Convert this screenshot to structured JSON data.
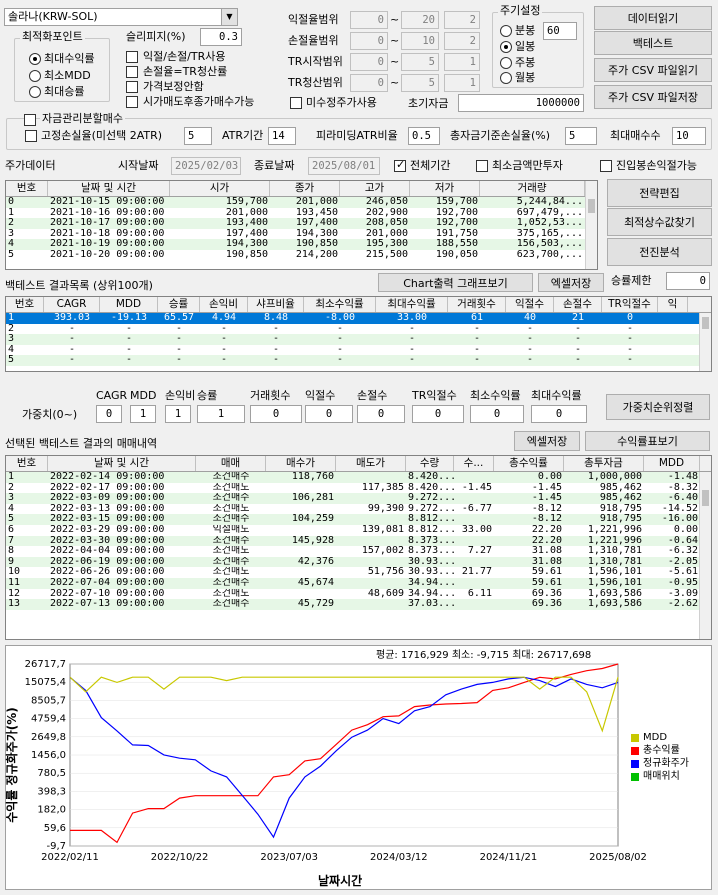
{
  "top": {
    "symbol_select": "솔라나(KRW-SOL)",
    "optimization": {
      "title": "최적화포인트",
      "options": [
        "최대수익률",
        "최소MDD",
        "최대승률"
      ],
      "selected": 0
    },
    "slippage_label": "슬리피지(%)",
    "slippage_value": "0.3",
    "checks": [
      {
        "label": "익절/손절/TR사용",
        "checked": false
      },
      {
        "label": "손절율=TR청산률",
        "checked": false
      },
      {
        "label": "가격보정안함",
        "checked": false
      },
      {
        "label": "시가매도후종가매수가능",
        "checked": false
      }
    ],
    "ranges": [
      {
        "label": "익절율범위",
        "from": "0",
        "to": "20",
        "step": "2"
      },
      {
        "label": "손절율범위",
        "from": "0",
        "to": "10",
        "step": "2"
      },
      {
        "label": "TR시작범위",
        "from": "0",
        "to": "5",
        "step": "1"
      },
      {
        "label": "TR청산범위",
        "from": "0",
        "to": "5",
        "step": "1"
      }
    ],
    "range_sep": "~",
    "unclosed_label": "미수정주가사용",
    "capital_label": "초기자금",
    "capital_value": "1000000",
    "period": {
      "title": "주기설정",
      "options": [
        "분봉",
        "일봉",
        "주봉",
        "월봉"
      ],
      "selected": 1,
      "minute_value": "60"
    },
    "buttons": [
      "데이터읽기",
      "백테스트",
      "주가 CSV 파일읽기",
      "주가 CSV 파일저장"
    ]
  },
  "split": {
    "title": "자금관리분할매수",
    "fixed_loss_label": "고정손실율(미선택 2ATR)",
    "fixed_loss_value": "5",
    "atr_label": "ATR기간",
    "atr_value": "14",
    "pyramid_label": "피라미딩ATR비율",
    "pyramid_value": "0.5",
    "total_loss_label": "총자금기준손실율(%)",
    "total_loss_value": "5",
    "max_buy_label": "최대매수수",
    "max_buy_value": "10"
  },
  "stock": {
    "title": "주가데이터",
    "start_label": "시작날짜",
    "start_value": "2025/02/03",
    "end_label": "종료날짜",
    "end_value": "2025/08/01",
    "all_period_label": "전체기간",
    "min_invest_label": "최소금액만투자",
    "entry_loss_label": "진입봉손익절가능",
    "headers": [
      "번호",
      "날짜 및 시간",
      "시가",
      "종가",
      "고가",
      "저가",
      "거래량"
    ],
    "rows": [
      [
        "0",
        "2021-10-15 09:00:00",
        "159,700",
        "201,000",
        "246,050",
        "159,700",
        "5,244,84..."
      ],
      [
        "1",
        "2021-10-16 09:00:00",
        "201,000",
        "193,450",
        "202,900",
        "192,700",
        "697,479,..."
      ],
      [
        "2",
        "2021-10-17 09:00:00",
        "193,400",
        "197,400",
        "208,050",
        "192,700",
        "1,052,53..."
      ],
      [
        "3",
        "2021-10-18 09:00:00",
        "197,400",
        "194,300",
        "201,000",
        "191,750",
        "375,165,..."
      ],
      [
        "4",
        "2021-10-19 09:00:00",
        "194,300",
        "190,850",
        "195,300",
        "188,550",
        "156,503,..."
      ],
      [
        "5",
        "2021-10-20 09:00:00",
        "190,850",
        "214,200",
        "215,500",
        "190,050",
        "623,700,..."
      ]
    ],
    "side_buttons": [
      "전략편집",
      "최적상수값찾기",
      "전진분석"
    ]
  },
  "backtest": {
    "title": "백테스트  결과목록 (상위100개)",
    "chart_btn": "Chart출력 그래프보기",
    "excel_btn": "엑셀저장",
    "limit_label": "승률제한",
    "limit_value": "0",
    "headers": [
      "번호",
      "CAGR",
      "MDD",
      "승률",
      "손익비",
      "샤프비율",
      "최소수익률",
      "최대수익률",
      "거래횟수",
      "익절수",
      "손절수",
      "TR익절수",
      "익"
    ],
    "rows": [
      [
        "1",
        "393.03",
        "-19.13",
        "65.57",
        "4.94",
        "8.48",
        "-8.00",
        "33.00",
        "61",
        "40",
        "21",
        "0",
        ""
      ],
      [
        "2",
        "-",
        "-",
        "-",
        "-",
        "-",
        "-",
        "-",
        "-",
        "-",
        "-",
        "-",
        ""
      ],
      [
        "3",
        "-",
        "-",
        "-",
        "-",
        "-",
        "-",
        "-",
        "-",
        "-",
        "-",
        "-",
        ""
      ],
      [
        "4",
        "-",
        "-",
        "-",
        "-",
        "-",
        "-",
        "-",
        "-",
        "-",
        "-",
        "-",
        ""
      ],
      [
        "5",
        "-",
        "-",
        "-",
        "-",
        "-",
        "-",
        "-",
        "-",
        "-",
        "-",
        "-",
        ""
      ]
    ],
    "weights_label": "가중치(0~)",
    "weight_headers": [
      "CAGR",
      "MDD",
      "손익비",
      "승률",
      "거래횟수",
      "익절수",
      "손절수",
      "TR익절수",
      "최소수익률",
      "최대수익률"
    ],
    "weight_values": [
      "0",
      "1",
      "1",
      "1",
      "0",
      "0",
      "0",
      "0",
      "0",
      "0"
    ],
    "weight_sort_btn": "가중치순위정렬"
  },
  "trades": {
    "title": "선택된 백테스트 결과의 매매내역",
    "excel_btn": "엑셀저장",
    "profit_btn": "수익률표보기",
    "headers": [
      "번호",
      "날짜 및 시간",
      "매매",
      "매수가",
      "매도가",
      "수량",
      "수...",
      "총수익률",
      "총투자금",
      "MDD"
    ],
    "rows": [
      [
        "1",
        "2022-02-14 09:00:00",
        "조건매수",
        "118,760",
        "",
        "8.420...",
        "",
        "0.00",
        "1,000,000",
        "-1.48"
      ],
      [
        "2",
        "2022-02-17 09:00:00",
        "조건매도",
        "",
        "117,385",
        "8.420...",
        "-1.45",
        "-1.45",
        "985,462",
        "-8.32"
      ],
      [
        "3",
        "2022-03-09 09:00:00",
        "조건매수",
        "106,281",
        "",
        "9.272...",
        "",
        "-1.45",
        "985,462",
        "-6.40"
      ],
      [
        "4",
        "2022-03-13 09:00:00",
        "조건매도",
        "",
        "99,390",
        "9.272...",
        "-6.77",
        "-8.12",
        "918,795",
        "-14.52"
      ],
      [
        "5",
        "2022-03-15 09:00:00",
        "조건매수",
        "104,259",
        "",
        "8.812...",
        "",
        "-8.12",
        "918,795",
        "-16.00"
      ],
      [
        "6",
        "2022-03-29 09:00:00",
        "익절매도",
        "",
        "139,081",
        "8.812...",
        "33.00",
        "22.20",
        "1,221,996",
        "0.00"
      ],
      [
        "7",
        "2022-03-30 09:00:00",
        "조건매수",
        "145,928",
        "",
        "8.373...",
        "",
        "22.20",
        "1,221,996",
        "-0.64"
      ],
      [
        "8",
        "2022-04-04 09:00:00",
        "조건매도",
        "",
        "157,002",
        "8.373...",
        "7.27",
        "31.08",
        "1,310,781",
        "-6.32"
      ],
      [
        "9",
        "2022-06-19 09:00:00",
        "조건매수",
        "42,376",
        "",
        "30.93...",
        "",
        "31.08",
        "1,310,781",
        "-2.05"
      ],
      [
        "10",
        "2022-06-26 09:00:00",
        "조건매도",
        "",
        "51,756",
        "30.93...",
        "21.77",
        "59.61",
        "1,596,101",
        "-5.61"
      ],
      [
        "11",
        "2022-07-04 09:00:00",
        "조건매수",
        "45,674",
        "",
        "34.94...",
        "",
        "59.61",
        "1,596,101",
        "-0.95"
      ],
      [
        "12",
        "2022-07-10 09:00:00",
        "조건매도",
        "",
        "48,609",
        "34.94...",
        "6.11",
        "69.36",
        "1,693,586",
        "-3.09"
      ],
      [
        "13",
        "2022-07-13 09:00:00",
        "조건매수",
        "45,729",
        "",
        "37.03...",
        "",
        "69.36",
        "1,693,586",
        "-2.62"
      ]
    ]
  },
  "chart_data": {
    "type": "line",
    "stats": "평균: 1716,929  최소: -9,715  최대: 26717,698",
    "ylabel": "수익률 정규화주가(%)",
    "xlabel": "날짜시간",
    "yticks": [
      "26717,7",
      "15075,4",
      "8505,7",
      "4759,4",
      "2649,8",
      "1456,0",
      "780,5",
      "398,3",
      "182,0",
      "59,6",
      "-9,7"
    ],
    "xticks": [
      "2022/02/11",
      "2022/10/22",
      "2023/07/03",
      "2024/03/12",
      "2024/11/21",
      "2025/08/02"
    ],
    "legend": [
      "MDD",
      "총수익률",
      "정규화주가",
      "매매위치"
    ],
    "colors": {
      "MDD": "#c8c800",
      "총수익률": "#ff0000",
      "정규화주가": "#0000ff",
      "매매위치": "#00c000"
    },
    "series": [
      {
        "name": "총수익률",
        "values": [
          0,
          0,
          0,
          -8,
          22,
          31,
          31,
          60,
          69,
          69,
          69,
          69,
          69,
          180,
          200,
          380,
          420,
          800,
          1500,
          1900,
          2700,
          2800,
          4200,
          4500,
          4700,
          4800,
          5000,
          8500,
          9500,
          12000,
          15000,
          14000,
          17000,
          20000,
          22000,
          26700
        ]
      },
      {
        "name": "정규화주가",
        "values": [
          15000,
          8500,
          2600,
          1450,
          780,
          760,
          500,
          430,
          400,
          240,
          180,
          70,
          20,
          -5,
          60,
          180,
          300,
          600,
          1100,
          1500,
          2500,
          2000,
          3500,
          4200,
          7000,
          9000,
          11000,
          12000,
          14000,
          15000,
          13000,
          10000,
          14000,
          11000,
          9500,
          12000
        ]
      },
      {
        "name": "MDD",
        "values": [
          15075,
          8000,
          15075,
          12000,
          15075,
          15075,
          9000,
          15075,
          15075,
          15075,
          13000,
          15075,
          15075,
          15075,
          15075,
          15075,
          15075,
          15075,
          15075,
          15075,
          15075,
          15075,
          15075,
          15075,
          15075,
          15075,
          15075,
          15075,
          15075,
          15075,
          9000,
          15075,
          15075,
          8000,
          1456,
          15075
        ]
      }
    ]
  }
}
